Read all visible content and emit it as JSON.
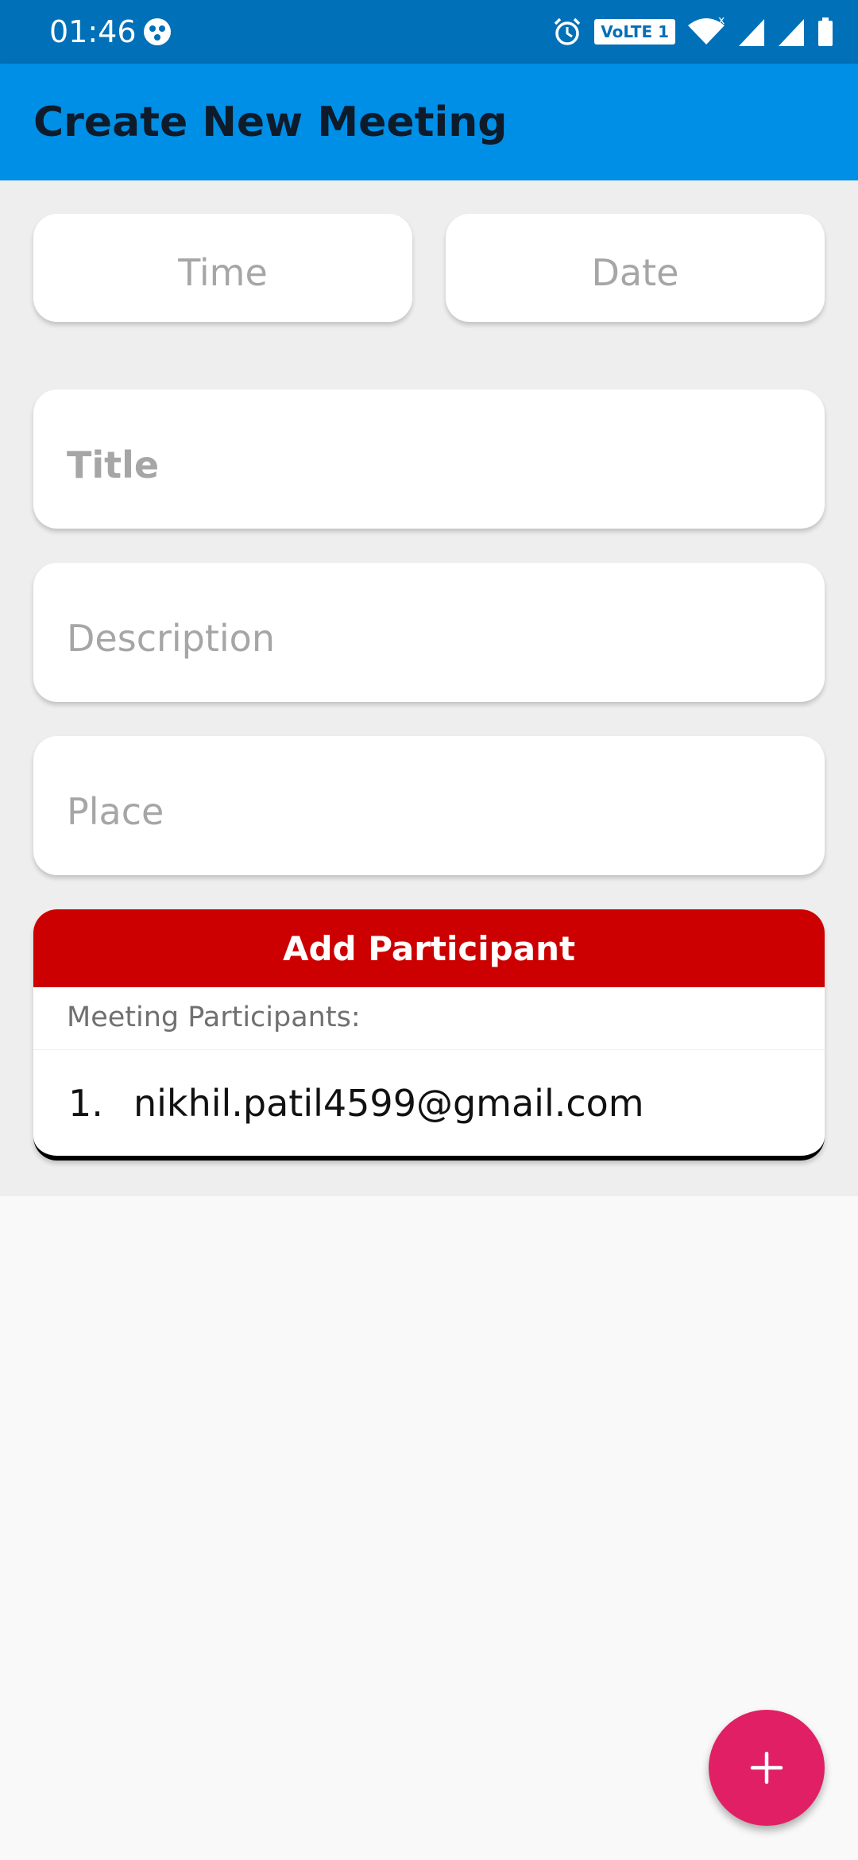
{
  "status_bar": {
    "time": "01:46",
    "network_badge": "VoLTE 1",
    "icons": [
      "dots-icon",
      "alarm-icon",
      "wifi-icon",
      "signal-icon",
      "signal-icon-2",
      "battery-icon"
    ]
  },
  "app_bar": {
    "title": "Create New Meeting"
  },
  "form": {
    "time_placeholder": "Time",
    "date_placeholder": "Date",
    "title_placeholder": "Title",
    "description_placeholder": "Description",
    "place_placeholder": "Place"
  },
  "participants": {
    "add_button_label": "Add Participant",
    "heading": "Meeting Participants:",
    "items": [
      {
        "number": "1.",
        "email": "nikhil.patil4599@gmail.com"
      }
    ]
  },
  "fab": {
    "icon": "plus-icon"
  },
  "colors": {
    "status_bar": "#0070b8",
    "app_bar": "#008fe6",
    "add_button": "#cc0000",
    "fab": "#e01f64"
  }
}
